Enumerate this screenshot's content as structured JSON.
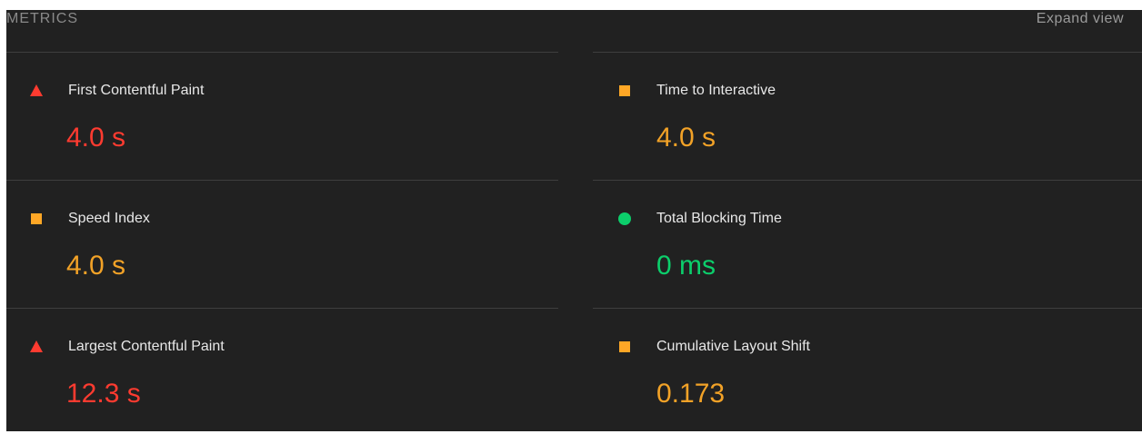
{
  "header": {
    "title": "METRICS",
    "expand_label": "Expand view"
  },
  "colors": {
    "fail": "#ff3b30",
    "average": "#f2a227",
    "pass": "#0cce6b",
    "background": "#212121"
  },
  "metrics": [
    {
      "label": "First Contentful Paint",
      "value": "4.0 s",
      "rating": "fail",
      "icon": "red-triangle-icon"
    },
    {
      "label": "Time to Interactive",
      "value": "4.0 s",
      "rating": "average",
      "icon": "orange-square-icon"
    },
    {
      "label": "Speed Index",
      "value": "4.0 s",
      "rating": "average",
      "icon": "orange-square-icon"
    },
    {
      "label": "Total Blocking Time",
      "value": "0 ms",
      "rating": "pass",
      "icon": "green-circle-icon"
    },
    {
      "label": "Largest Contentful Paint",
      "value": "12.3 s",
      "rating": "fail",
      "icon": "red-triangle-icon"
    },
    {
      "label": "Cumulative Layout Shift",
      "value": "0.173",
      "rating": "average",
      "icon": "orange-square-icon"
    }
  ]
}
